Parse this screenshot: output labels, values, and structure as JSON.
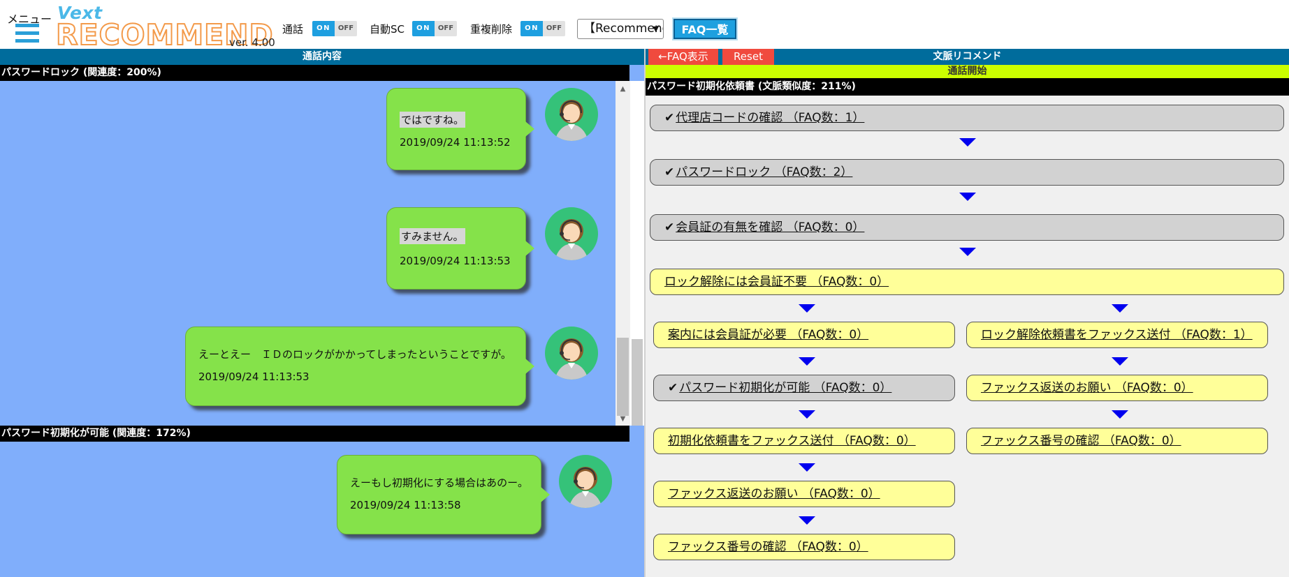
{
  "header": {
    "menu_label": "メニュー",
    "logo_top": "Vext",
    "logo_bottom": "RECOMMEND",
    "version": "ver. 4.00",
    "toggles": [
      {
        "label": "通話",
        "on": "ON",
        "off": "OFF",
        "state": "on"
      },
      {
        "label": "自動SC",
        "on": "ON",
        "off": "OFF",
        "state": "on"
      },
      {
        "label": "重複削除",
        "on": "ON",
        "off": "OFF",
        "state": "on"
      }
    ],
    "select_value": "【Recommend",
    "faq_list_button": "FAQ一覧"
  },
  "left": {
    "title": "通話内容",
    "sections": [
      {
        "title": "パスワードロック (関連度：200%)",
        "messages": [
          {
            "text": "ではですね。",
            "time": "2019/09/24 11:13:52"
          },
          {
            "text": "すみません。",
            "time": "2019/09/24 11:13:53"
          },
          {
            "text": "えーとえー　ＩＤのロックがかかってしまったということですが。",
            "time": "2019/09/24 11:13:53"
          }
        ]
      },
      {
        "title": "パスワード初期化が可能 (関連度：172%)",
        "messages": [
          {
            "text": "えーもし初期化にする場合はあのー。",
            "time": "2019/09/24 11:13:58"
          }
        ]
      }
    ]
  },
  "right": {
    "back_button": "←FAQ表示",
    "reset_button": "Reset",
    "title": "文脈リコメンド",
    "call_start": "通話開始",
    "section_title": "パスワード初期化依頼書 (文脈類似度：211%)",
    "check_mark": "✔",
    "nodes": [
      {
        "label": "代理店コードの確認 （FAQ数：1）",
        "checked": true,
        "color": "gray"
      },
      {
        "label": "パスワードロック （FAQ数：2）",
        "checked": true,
        "color": "gray"
      },
      {
        "label": "会員証の有無を確認 （FAQ数：0）",
        "checked": true,
        "color": "gray"
      },
      {
        "label": "ロック解除には会員証不要 （FAQ数：0）",
        "checked": false,
        "color": "yellow"
      },
      {
        "label": "案内には会員証が必要 （FAQ数：0）",
        "checked": false,
        "color": "yellow"
      },
      {
        "label": "パスワード初期化が可能 （FAQ数：0）",
        "checked": true,
        "color": "gray"
      },
      {
        "label": "初期化依頼書をファックス送付 （FAQ数：0）",
        "checked": false,
        "color": "yellow"
      },
      {
        "label": "ファックス返送のお願い （FAQ数：0）",
        "checked": false,
        "color": "yellow"
      },
      {
        "label": "ファックス番号の確認 （FAQ数：0）",
        "checked": false,
        "color": "yellow"
      },
      {
        "label": "ロック解除依頼書をファックス送付 （FAQ数：1）",
        "checked": false,
        "color": "yellow"
      },
      {
        "label": "ファックス返送のお願い （FAQ数：0）",
        "checked": false,
        "color": "yellow"
      },
      {
        "label": "ファックス番号の確認 （FAQ数：0）",
        "checked": false,
        "color": "yellow"
      }
    ]
  },
  "colors": {
    "accent": "#1e9fe0",
    "pane_header": "#006c9c",
    "chat_bg": "#80aefb",
    "bubble": "#85e24a",
    "node_gray": "#d2d2d2",
    "node_yellow": "#ffff99",
    "call_start": "#ccff00",
    "reset": "#f04a3e"
  }
}
